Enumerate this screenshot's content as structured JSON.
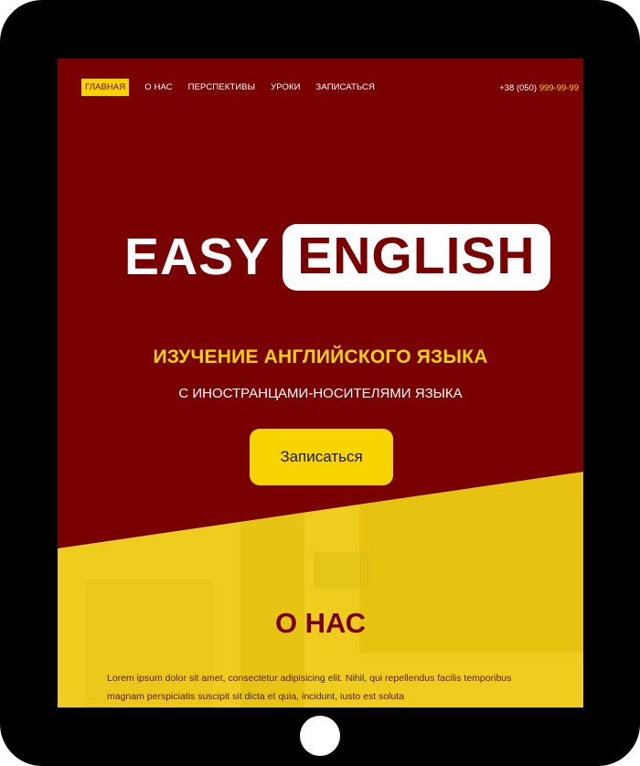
{
  "nav": {
    "items": [
      {
        "label": "ГЛАВНАЯ",
        "active": true
      },
      {
        "label": "О НАС",
        "active": false
      },
      {
        "label": "ПЕРСПЕКТИВЫ",
        "active": false
      },
      {
        "label": "УРОКИ",
        "active": false
      },
      {
        "label": "ЗАПИСАТЬСЯ",
        "active": false
      }
    ],
    "phone_prefix": "+38 (050) ",
    "phone_number": "999-99-99"
  },
  "hero": {
    "logo_easy": "EASY",
    "logo_english": "ENGLISH",
    "subtitle1": "ИЗУЧЕНИЕ АНГЛИЙСКОГО ЯЗЫКА",
    "subtitle2": "С ИНОСТРАНЦАМИ-НОСИТЕЛЯМИ ЯЗЫКА",
    "cta_label": "Записаться"
  },
  "about": {
    "title": "О НАС",
    "text": "Lorem ipsum dolor sit amet, consectetur adipisicing elit. Nihil, qui repellendus facilis temporibus magnam perspiciatis suscipit sit dicta et quia, incidunt, iusto est soluta"
  },
  "colors": {
    "primary": "#780000",
    "accent": "#f8d400",
    "device": "#000000"
  }
}
